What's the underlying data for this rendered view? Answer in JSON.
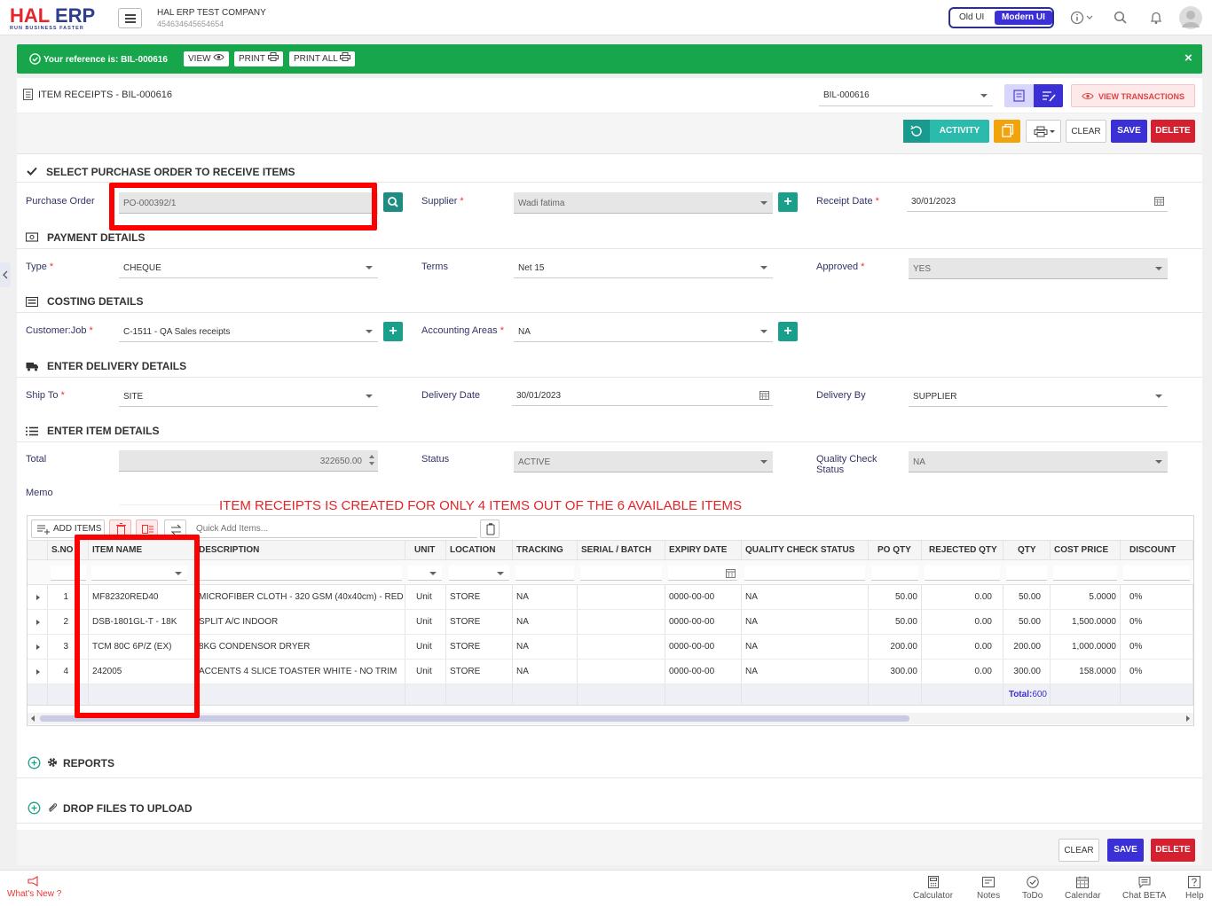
{
  "app": {
    "logo_main": "HAL ERP",
    "logo_hal": "HAL",
    "logo_erp": "ERP",
    "logo_tagline": "RUN BUSINESS FASTER",
    "company_name": "HAL ERP TEST COMPANY",
    "company_id": "454634645654654",
    "old_ui": "Old UI",
    "modern_ui": "Modern UI"
  },
  "banner": {
    "reference_label": "Your reference is:",
    "reference": "BIL-000616",
    "view": "VIEW",
    "print": "PRINT",
    "print_all": "PRINT ALL",
    "close": "×"
  },
  "header": {
    "title": "ITEM RECEIPTS - BIL-000616",
    "record_select": "BIL-000616",
    "view_transactions": "VIEW TRANSACTIONS"
  },
  "toolbar": {
    "activity": "ACTIVITY",
    "clear": "CLEAR",
    "save": "SAVE",
    "delete": "DELETE"
  },
  "sections": {
    "purchase_order": "SELECT PURCHASE ORDER TO RECEIVE ITEMS",
    "payment": "PAYMENT DETAILS",
    "costing": "COSTING DETAILS",
    "delivery": "ENTER DELIVERY DETAILS",
    "items": "ENTER ITEM DETAILS",
    "reports": "REPORTS",
    "upload": "DROP FILES TO UPLOAD"
  },
  "form": {
    "purchase_order_label": "Purchase Order",
    "purchase_order": "PO-000392/1",
    "supplier_label": "Supplier",
    "supplier": "Wadi fatima",
    "receipt_date_label": "Receipt Date",
    "receipt_date": "30/01/2023",
    "type_label": "Type",
    "type": "CHEQUE",
    "terms_label": "Terms",
    "terms": "Net 15",
    "approved_label": "Approved",
    "approved": "YES",
    "customer_job_label": "Customer:Job",
    "customer_job": "C-1511 - QA Sales receipts",
    "accounting_areas_label": "Accounting Areas",
    "accounting_areas": "NA",
    "ship_to_label": "Ship To",
    "ship_to": "SITE",
    "delivery_date_label": "Delivery Date",
    "delivery_date": "30/01/2023",
    "delivery_by_label": "Delivery By",
    "delivery_by": "SUPPLIER",
    "total_label": "Total",
    "total": "322650.00",
    "status_label": "Status",
    "status": "ACTIVE",
    "qc_status_label_1": "Quality Check",
    "qc_status_label_2": "Status",
    "qc_status": "NA",
    "memo_label": "Memo"
  },
  "annotation": "ITEM RECEIPTS IS CREATED FOR ONLY 4 ITEMS OUT OF THE 6 AVAILABLE ITEMS",
  "grid": {
    "add_items": "ADD ITEMS",
    "quick_add_placeholder": "Quick Add Items...",
    "columns": [
      "S.NO",
      "ITEM NAME",
      "DESCRIPTION",
      "UNIT",
      "LOCATION",
      "TRACKING",
      "SERIAL / BATCH",
      "EXPIRY DATE",
      "QUALITY CHECK STATUS",
      "PO QTY",
      "REJECTED QTY",
      "QTY",
      "COST PRICE",
      "DISCOUNT"
    ],
    "rows": [
      {
        "sno": "1",
        "item": "MF82320RED40",
        "desc": "MICROFIBER CLOTH - 320 GSM (40x40cm) - RED",
        "unit": "Unit",
        "loc": "STORE",
        "tracking": "NA",
        "serial": "",
        "expiry": "0000-00-00",
        "qc": "NA",
        "po_qty": "50.00",
        "rej": "0.00",
        "qty": "50.00",
        "cost": "5.0000",
        "disc": "0%"
      },
      {
        "sno": "2",
        "item": "DSB-1801GL-T - 18K",
        "desc": "SPLIT A/C INDOOR",
        "unit": "Unit",
        "loc": "STORE",
        "tracking": "NA",
        "serial": "",
        "expiry": "0000-00-00",
        "qc": "NA",
        "po_qty": "50.00",
        "rej": "0.00",
        "qty": "50.00",
        "cost": "1,500.0000",
        "disc": "0%"
      },
      {
        "sno": "3",
        "item": "TCM 80C 6P/Z (EX)",
        "desc": "8KG CONDENSOR DRYER",
        "unit": "Unit",
        "loc": "STORE",
        "tracking": "NA",
        "serial": "",
        "expiry": "0000-00-00",
        "qc": "NA",
        "po_qty": "200.00",
        "rej": "0.00",
        "qty": "200.00",
        "cost": "1,000.0000",
        "disc": "0%"
      },
      {
        "sno": "4",
        "item": "242005",
        "desc": "ACCENTS 4 SLICE TOASTER WHITE - NO TRIM",
        "unit": "Unit",
        "loc": "STORE",
        "tracking": "NA",
        "serial": "",
        "expiry": "0000-00-00",
        "qc": "NA",
        "po_qty": "300.00",
        "rej": "0.00",
        "qty": "300.00",
        "cost": "158.0000",
        "disc": "0%"
      }
    ],
    "total_label": "Total:",
    "total_qty": "600"
  },
  "bottom": {
    "clear": "CLEAR",
    "save": "SAVE",
    "delete": "DELETE"
  },
  "footer": {
    "whats_new": "What's New ?",
    "calculator": "Calculator",
    "notes": "Notes",
    "todo": "ToDo",
    "calendar": "Calendar",
    "chat": "Chat BETA",
    "help": "Help"
  },
  "colors": {
    "brand_red": "#e4252b",
    "brand_blue": "#2d3f8c",
    "success": "#17a64c",
    "teal": "#1aa08a",
    "save": "#3b2fd6",
    "delete": "#d5202f",
    "annotation": "#ff0000"
  },
  "icons": [
    "check-circle-icon",
    "eye-icon",
    "print-icon",
    "document-icon",
    "refresh-icon",
    "copy-icon",
    "info-icon",
    "search-icon",
    "bell-icon",
    "calendar-icon",
    "plus-icon",
    "trash-icon",
    "swap-icon",
    "calculator-icon",
    "notes-icon",
    "todo-icon",
    "chat-icon",
    "help-icon"
  ]
}
